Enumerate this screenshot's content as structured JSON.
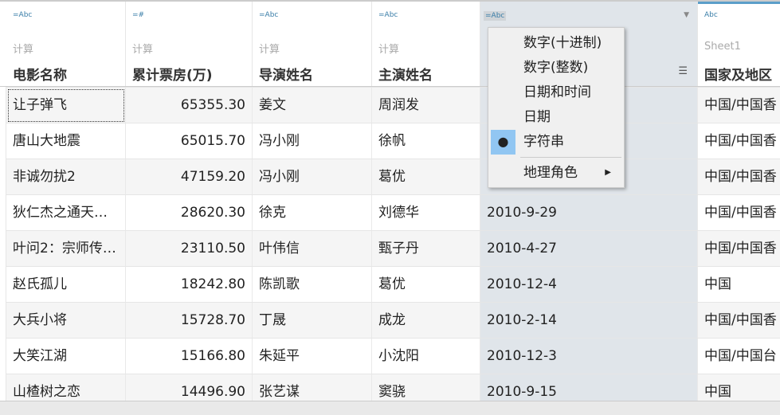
{
  "columns": [
    {
      "type": "=Abc",
      "source": "计算",
      "name": "电影名称"
    },
    {
      "type": "=#",
      "source": "计算",
      "name": "累计票房(万)"
    },
    {
      "type": "=Abc",
      "source": "计算",
      "name": "导演姓名"
    },
    {
      "type": "=Abc",
      "source": "计算",
      "name": "主演姓名"
    },
    {
      "type": "=Abc",
      "source": "",
      "name": ""
    },
    {
      "type": "Abc",
      "source": "Sheet1",
      "name": "国家及地区"
    }
  ],
  "rows": [
    [
      "让子弹飞",
      "65355.30",
      "姜文",
      "周润发",
      "",
      "中国/中国香"
    ],
    [
      "唐山大地震",
      "65015.70",
      "冯小刚",
      "徐帆",
      "",
      "中国/中国香"
    ],
    [
      "非诚勿扰2",
      "47159.20",
      "冯小刚",
      "葛优",
      "",
      "中国/中国香"
    ],
    [
      "狄仁杰之通天…",
      "28620.30",
      "徐克",
      "刘德华",
      "2010-9-29",
      "中国/中国香"
    ],
    [
      "叶问2：宗师传…",
      "23110.50",
      "叶伟信",
      "甄子丹",
      "2010-4-27",
      "中国/中国香"
    ],
    [
      "赵氏孤儿",
      "18242.80",
      "陈凯歌",
      "葛优",
      "2010-12-4",
      "中国"
    ],
    [
      "大兵小将",
      "15728.70",
      "丁晟",
      "成龙",
      "2010-2-14",
      "中国/中国香"
    ],
    [
      "大笑江湖",
      "15166.80",
      "朱延平",
      "小沈阳",
      "2010-12-3",
      "中国/中国台"
    ],
    [
      "山楂树之恋",
      "14496.90",
      "张艺谋",
      "窦骁",
      "2010-9-15",
      "中国"
    ]
  ],
  "menu": {
    "items": [
      "数字(十进制)",
      "数字(整数)",
      "日期和时间",
      "日期",
      "字符串"
    ],
    "selected_index": 4,
    "submenu": "地理角色"
  },
  "colors": {
    "accent": "#3a7ea8",
    "selected_column": "#e0e5ea",
    "menu_selection": "#91c6f2"
  }
}
